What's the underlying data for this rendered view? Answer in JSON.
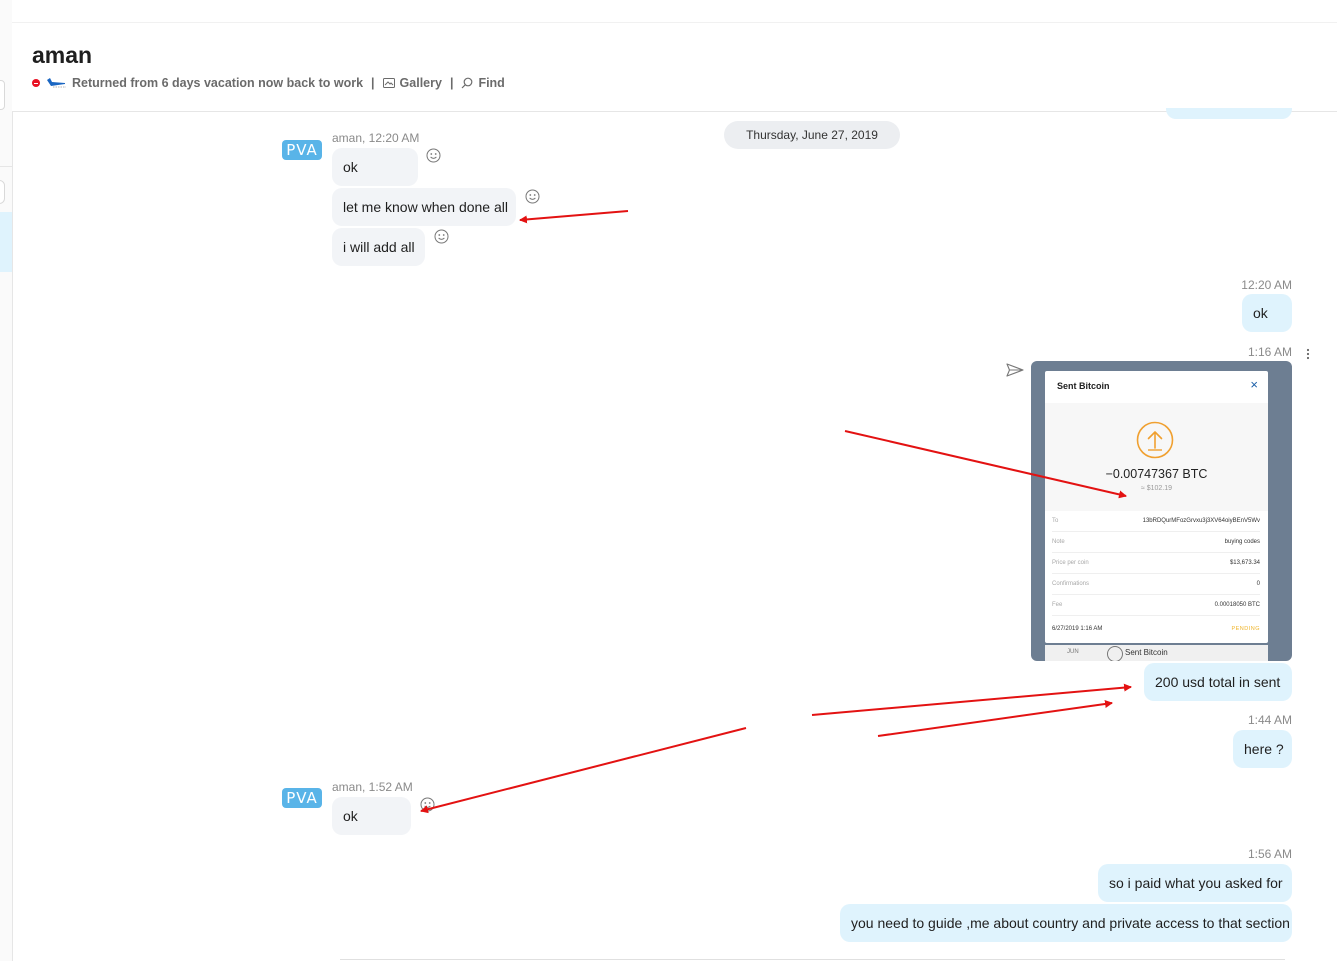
{
  "header": {
    "contact_name": "aman",
    "mood_message": "Returned from 6 days vacation now back to work",
    "separator": "|",
    "gallery_label": "Gallery",
    "find_label": "Find"
  },
  "date_divider": "Thursday, June 27, 2019",
  "messages": {
    "group1": {
      "avatar_text": "PVA",
      "meta": "aman, 12:20 AM",
      "items": [
        "ok",
        "let me know when done all",
        "i will add all"
      ]
    },
    "out1": {
      "time": "12:20 AM",
      "text": "ok"
    },
    "out2": {
      "time": "1:16 AM"
    },
    "out3": {
      "text": "200 usd total in sent"
    },
    "out4": {
      "time": "1:44 AM",
      "text": "here ?"
    },
    "group2": {
      "avatar_text": "PVA",
      "meta": "aman, 1:52 AM",
      "text": "ok"
    },
    "out5": {
      "time": "1:56 AM",
      "items": [
        "so i paid what you asked for",
        "you need to guide ,me about country and private access to that section"
      ]
    }
  },
  "bitcoin_receipt": {
    "title": "Sent Bitcoin",
    "close": "×",
    "amount": "−0.00747367 BTC",
    "fiat": "≈ $102.19",
    "rows": [
      {
        "key": "To",
        "value": "13bRDQurMFozGrvxu3j3XV64oiyBEnV5Wv"
      },
      {
        "key": "Note",
        "value": "buying codes"
      },
      {
        "key": "Price per coin",
        "value": "$13,673.34"
      },
      {
        "key": "Confirmations",
        "value": "0"
      },
      {
        "key": "Fee",
        "value": "0.00018050 BTC"
      }
    ],
    "footer_date": "6/27/2019 1:16 AM",
    "footer_status": "PENDING",
    "below_date": "JUN",
    "below_label": "Sent Bitcoin"
  },
  "colors": {
    "outgoing_bubble": "#dff3fd",
    "incoming_bubble": "#f2f4f7",
    "avatar": "#59b4e8",
    "annotation_arrow": "#e31212",
    "pending": "#f0b429",
    "btc_icon": "#f0a030"
  },
  "icons": [
    "smiley-icon",
    "gallery-icon",
    "search-icon",
    "send-icon",
    "more-vertical-icon",
    "do-not-disturb-icon",
    "plane-icon",
    "upload-arrow-icon",
    "close-icon"
  ]
}
